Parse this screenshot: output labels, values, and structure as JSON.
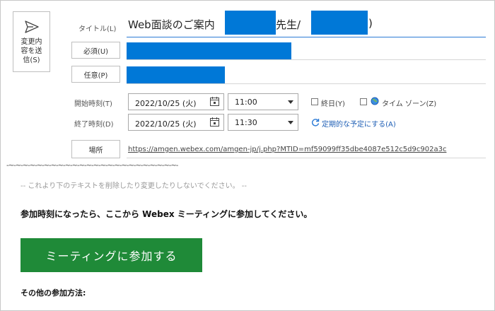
{
  "send_button": {
    "label": "変更内\n容を送\n信(S)",
    "icon": "send-icon"
  },
  "labels": {
    "title": "タイトル(L)",
    "required": "必須(U)",
    "optional": "任意(P)",
    "start": "開始時刻(T)",
    "end": "終了時刻(D)",
    "location": "場所"
  },
  "subject": {
    "prefix": "Web面談のご案内",
    "middle": "先生/",
    "suffix": ")"
  },
  "start": {
    "date": "2022/10/25 (火)",
    "time": "11:00"
  },
  "end": {
    "date": "2022/10/25 (火)",
    "time": "11:30"
  },
  "options": {
    "allday": "終日(Y)",
    "timezone": "タイム ゾーン(Z)",
    "recurring": "定期的な予定にする(A)"
  },
  "location_url": "https://amgen.webex.com/amgen-jp/j.php?MTID=mf59099ff35dbe4087e512c5d9c902a3c",
  "body": {
    "wavy": "-~-~-~-~-~-~-~-~-~-~-~-~-~-~-~-~-~-~-~-~-~-~-~-~-",
    "notice": "-- これより下のテキストを削除したり変更したりしないでください。 --",
    "instruction": "参加時刻になったら、ここから Webex ミーティングに参加してください。",
    "join_button": "ミーティングに参加する",
    "other_methods": "その他の参加方法:"
  },
  "colors": {
    "accent": "#0078d7",
    "join_button": "#1f8a38",
    "link": "#1f5fb5"
  }
}
